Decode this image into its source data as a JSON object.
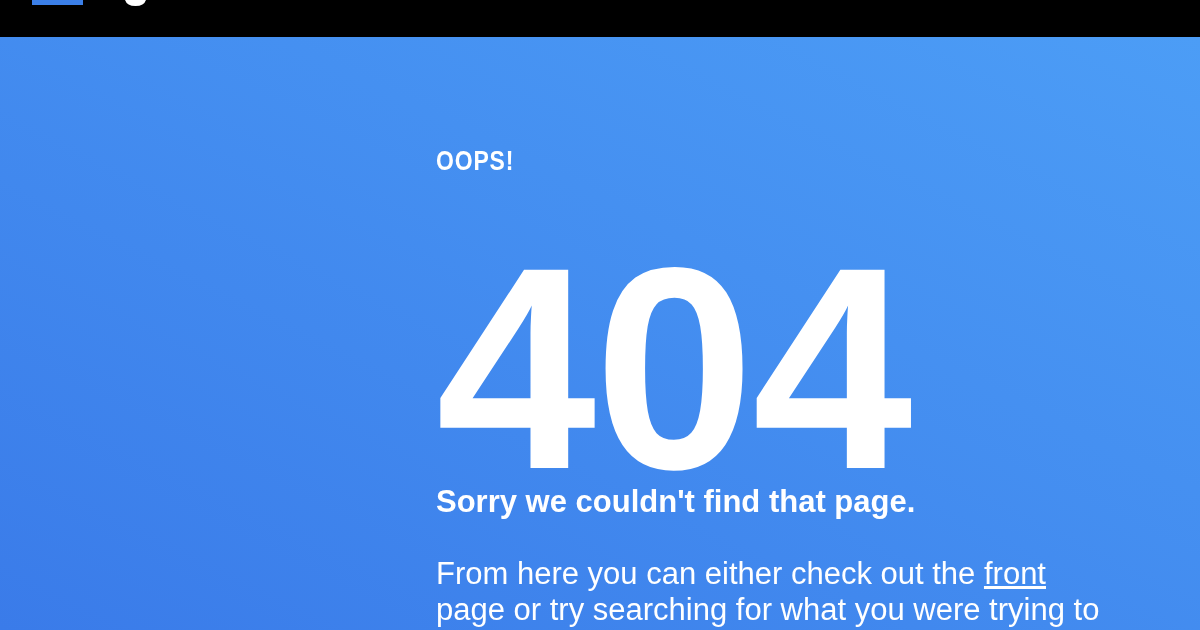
{
  "eyebrow": "OOPS!",
  "code": "404",
  "message": "Sorry we couldn't find that page.",
  "help": {
    "text_before": "From here you can either check out the ",
    "link": "front",
    "text_after": " page or try searching for what you were trying to"
  }
}
